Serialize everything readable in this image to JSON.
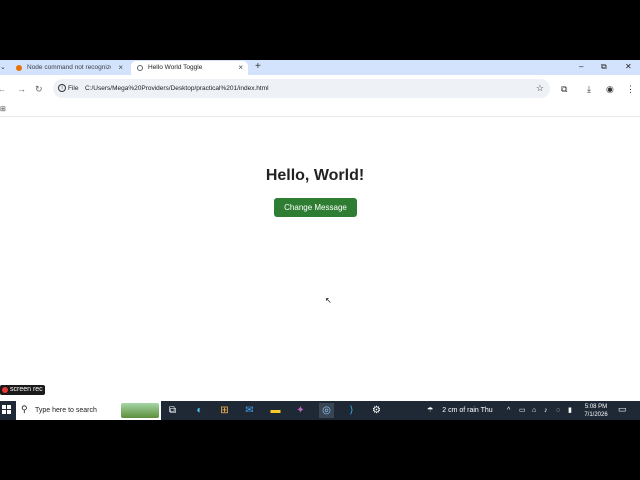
{
  "tabs": [
    {
      "title": "Node command not recognize",
      "close": "×"
    },
    {
      "title": "Hello World Toggle",
      "close": "×"
    }
  ],
  "tab_strip": {
    "menu_glyph": "⌄",
    "new_tab": "+"
  },
  "window_controls": {
    "minimize": "–",
    "restore": "⧉",
    "close": "✕"
  },
  "toolbar": {
    "back": "←",
    "forward": "→",
    "reload": "↻",
    "extensions": "⧉",
    "downloads": "⤓",
    "profile": "◉",
    "menu": "⋮"
  },
  "address_bar": {
    "scheme_label": "File",
    "info_glyph": "i",
    "url": "C:/Users/Mega%20Providers/Desktop/practical%201/index.html",
    "bookmark": "☆"
  },
  "bookmarks_bar": {
    "apps": "⊞"
  },
  "page": {
    "heading": "Hello, World!",
    "button_label": "Change Message",
    "button_color": "#2e7d32",
    "cursor": "↖"
  },
  "recording_badge": {
    "label": "screen rec"
  },
  "taskbar": {
    "search_placeholder": "Type here to search",
    "search_glyph": "⚲",
    "apps": [
      {
        "name": "task-view",
        "glyph": "⧉"
      },
      {
        "name": "edge",
        "glyph": "◐"
      },
      {
        "name": "store",
        "glyph": "⊞"
      },
      {
        "name": "outlook",
        "glyph": "✉"
      },
      {
        "name": "file-explorer",
        "glyph": "▬"
      },
      {
        "name": "copilot",
        "glyph": "✦"
      },
      {
        "name": "chrome",
        "glyph": "◎"
      },
      {
        "name": "vscode",
        "glyph": "⟩"
      },
      {
        "name": "settings",
        "glyph": "⚙"
      }
    ],
    "weather": "2 cm of rain Thu",
    "weather_glyph": "☂",
    "tray": [
      "^",
      "▭",
      "⌂",
      "♪",
      "◌",
      "▮"
    ],
    "time": "5:08 PM",
    "date": "7/1/2026",
    "notifications": "▭",
    "bar_color": "#1f2936"
  }
}
